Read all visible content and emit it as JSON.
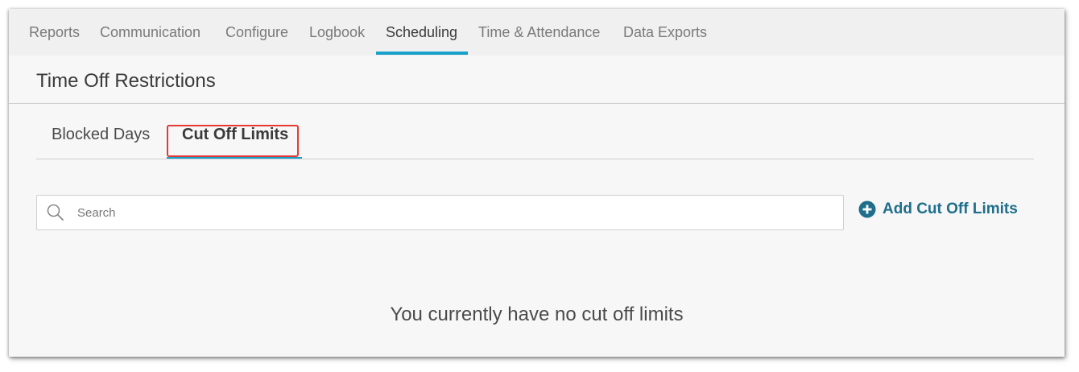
{
  "topnav": {
    "items": [
      {
        "label": "Reports"
      },
      {
        "label": "Communication"
      },
      {
        "label": "Configure"
      },
      {
        "label": "Logbook"
      },
      {
        "label": "Scheduling"
      },
      {
        "label": "Time & Attendance"
      },
      {
        "label": "Data Exports"
      }
    ],
    "active": "Scheduling"
  },
  "page": {
    "title": "Time Off Restrictions"
  },
  "subtabs": {
    "items": [
      {
        "label": "Blocked Days"
      },
      {
        "label": "Cut Off Limits"
      }
    ],
    "active": "Cut Off Limits"
  },
  "search": {
    "placeholder": "Search",
    "value": "",
    "icon": "search-icon"
  },
  "actions": {
    "add_label": "Add Cut Off Limits",
    "add_icon": "plus-circle-icon"
  },
  "empty_state": {
    "message": "You currently have no cut off limits"
  },
  "colors": {
    "accent": "#19a0c8",
    "link": "#1e6e8c",
    "highlight": "#e53935"
  }
}
